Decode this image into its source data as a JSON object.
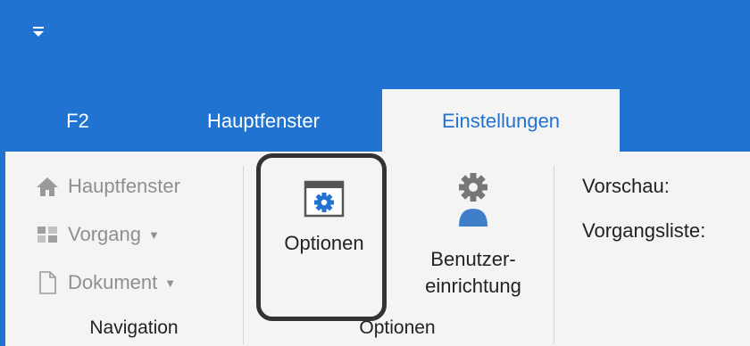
{
  "quick_access": {
    "icon": "dropdown-arrow-icon"
  },
  "tabs": [
    {
      "label": "F2"
    },
    {
      "label": "Hauptfenster"
    },
    {
      "label": "Einstellungen",
      "active": true
    }
  ],
  "navigation": {
    "items": [
      {
        "label": "Hauptfenster",
        "icon": "home-icon",
        "dropdown": false
      },
      {
        "label": "Vorgang",
        "icon": "process-icon",
        "dropdown": true
      },
      {
        "label": "Dokument",
        "icon": "document-icon",
        "dropdown": true
      }
    ],
    "group_label": "Navigation"
  },
  "options_group": {
    "optionen_button": "Optionen",
    "benutzer_line1": "Benutzer-",
    "benutzer_line2": "einrichtung",
    "group_label": "Optionen"
  },
  "settings": {
    "vorschau_label": "Vorschau:",
    "vorgangsliste_label": "Vorgangsliste:"
  },
  "colors": {
    "accent": "#2173d1",
    "ribbon": "#f4f4f4",
    "disabled_text": "#8f8f8f"
  }
}
